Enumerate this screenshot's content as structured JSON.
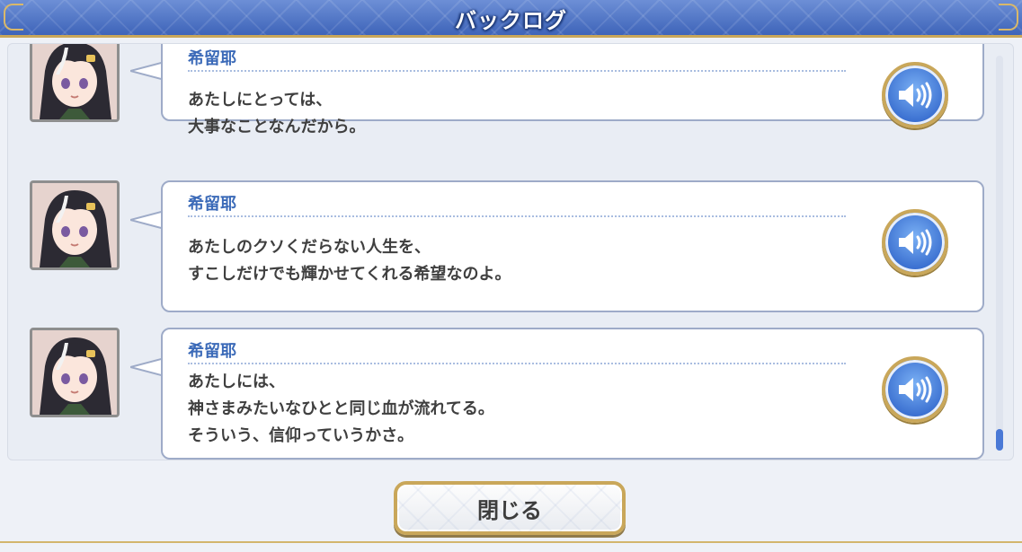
{
  "header": {
    "title": "バックログ"
  },
  "entries": [
    {
      "speaker": "希留耶",
      "lines": [
        "あたしにとっては、",
        "大事なことなんだから。"
      ]
    },
    {
      "speaker": "希留耶",
      "lines": [
        "あたしのクソくだらない人生を、",
        "すこしだけでも輝かせてくれる希望なのよ。"
      ]
    },
    {
      "speaker": "希留耶",
      "lines": [
        "あたしには、",
        "神さまみたいなひとと同じ血が流れてる。",
        "そういう、信仰っていうかさ。"
      ]
    }
  ],
  "icons": {
    "voice": "speaker-icon",
    "avatar": "character-portrait"
  },
  "footer": {
    "close_label": "閉じる"
  },
  "colors": {
    "header": "#3e64b9",
    "speaker_name": "#3b6ab8",
    "gold_border": "#c9a75a",
    "voice_button": "#3a6fd0"
  }
}
